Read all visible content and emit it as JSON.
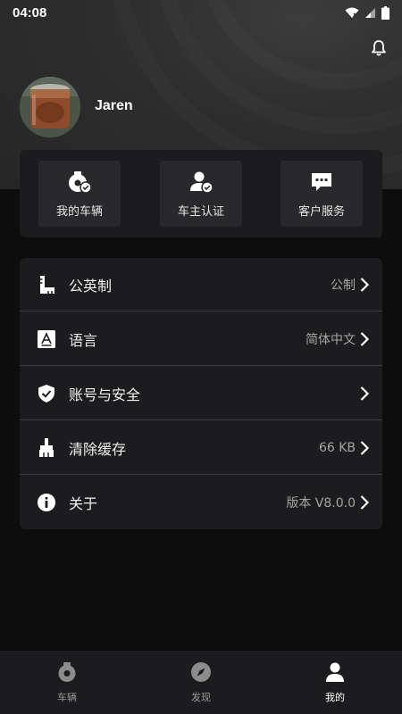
{
  "status_bar": {
    "time": "04:08"
  },
  "profile": {
    "username": "Jaren"
  },
  "quick_actions": [
    {
      "label": "我的车辆",
      "icon": "car-wheel-check-icon"
    },
    {
      "label": "车主认证",
      "icon": "user-check-icon"
    },
    {
      "label": "客户服务",
      "icon": "chat-icon"
    }
  ],
  "settings": [
    {
      "label": "公英制",
      "value": "公制",
      "icon": "ruler-icon"
    },
    {
      "label": "语言",
      "value": "简体中文",
      "icon": "language-icon"
    },
    {
      "label": "账号与安全",
      "value": "",
      "icon": "shield-check-icon"
    },
    {
      "label": "清除缓存",
      "value": "66 KB",
      "icon": "broom-icon"
    },
    {
      "label": "关于",
      "value": "版本 V8.0.0",
      "icon": "info-icon"
    }
  ],
  "tabs": [
    {
      "label": "车辆",
      "icon": "car-icon",
      "active": false
    },
    {
      "label": "发现",
      "icon": "compass-icon",
      "active": false
    },
    {
      "label": "我的",
      "icon": "profile-icon",
      "active": true
    }
  ],
  "colors": {
    "header_bg": "#2e2e2e",
    "page_bg": "#0d0d0e",
    "card_bg": "#1c1c1e",
    "quick_button_bg": "#29292c",
    "text_primary": "#f0f0f0",
    "text_secondary": "#a5a5a5"
  }
}
